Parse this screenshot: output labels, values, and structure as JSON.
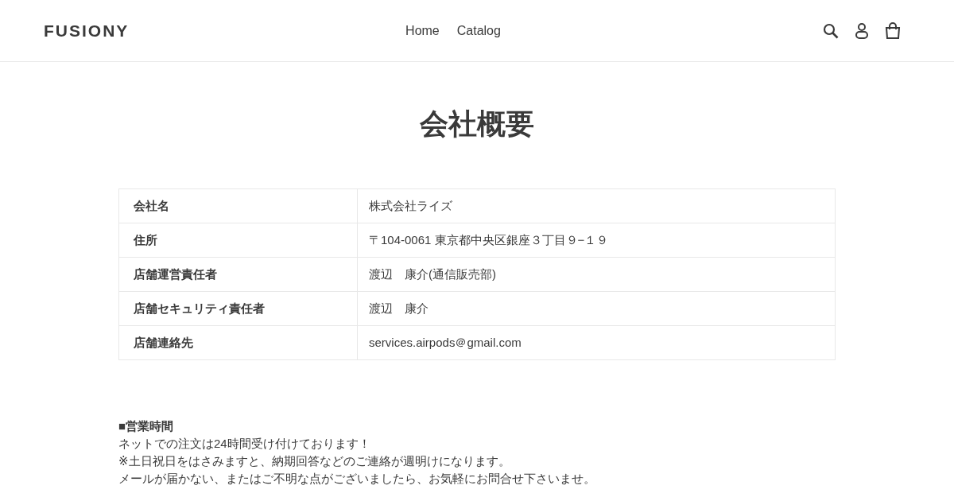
{
  "header": {
    "logo": "FUSIONY",
    "nav": [
      {
        "label": "Home"
      },
      {
        "label": "Catalog"
      }
    ]
  },
  "page": {
    "title": "会社概要",
    "table": {
      "rows": [
        {
          "label": "会社名",
          "value": "株式会社ライズ"
        },
        {
          "label": "住所",
          "value": "〒104-0061 東京都中央区銀座３丁目９−１９"
        },
        {
          "label": "店舗運営責任者",
          "value": "渡辺　康介(通信販売部)"
        },
        {
          "label": "店舗セキュリティ責任者",
          "value": "渡辺　康介"
        },
        {
          "label": "店舗連絡先",
          "value": "services.airpods＠gmail.com"
        }
      ]
    },
    "notes": {
      "heading": "■営業時間",
      "lines": [
        "ネットでの注文は24時間受け付けております！",
        "※土日祝日をはさみますと、納期回答などのご連絡が週明けになります。",
        "メールが届かない、またはご不明な点がございましたら、お気軽にお問合せ下さいませ。"
      ]
    }
  }
}
